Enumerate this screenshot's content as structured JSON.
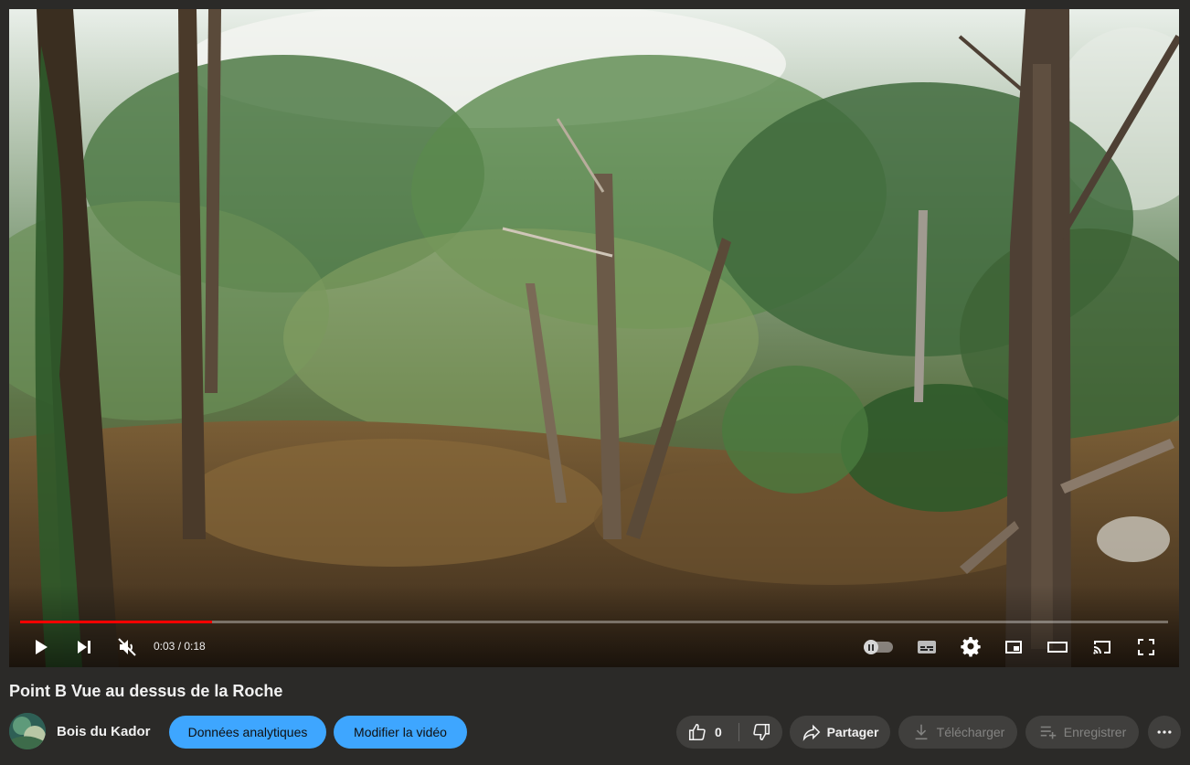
{
  "video": {
    "title": "Point B Vue au dessus de la Roche",
    "time_current": "0:03",
    "time_separator": " / ",
    "time_total": "0:18",
    "progress": 0.167
  },
  "channel": {
    "name": "Bois du Kador"
  },
  "actions": {
    "analytics_label": "Données analytiques",
    "edit_label": "Modifier la vidéo",
    "like_count": "0",
    "share_label": "Partager",
    "download_label": "Télécharger",
    "save_label": "Enregistrer"
  },
  "colors": {
    "accent_blue": "#3ea6ff",
    "progress_red": "#ff0000"
  },
  "icons": {
    "play": "play-icon",
    "next": "next-icon",
    "mute": "mute-icon",
    "subtitles": "subtitles-icon",
    "settings": "gear-icon",
    "miniplayer": "miniplayer-icon",
    "theater": "theater-icon",
    "cast": "cast-icon",
    "fullscreen": "fullscreen-icon",
    "like": "thumbs-up-icon",
    "dislike": "thumbs-down-icon",
    "share": "share-icon",
    "download": "download-icon",
    "save": "playlist-add-icon",
    "more": "more-horizontal-icon"
  }
}
